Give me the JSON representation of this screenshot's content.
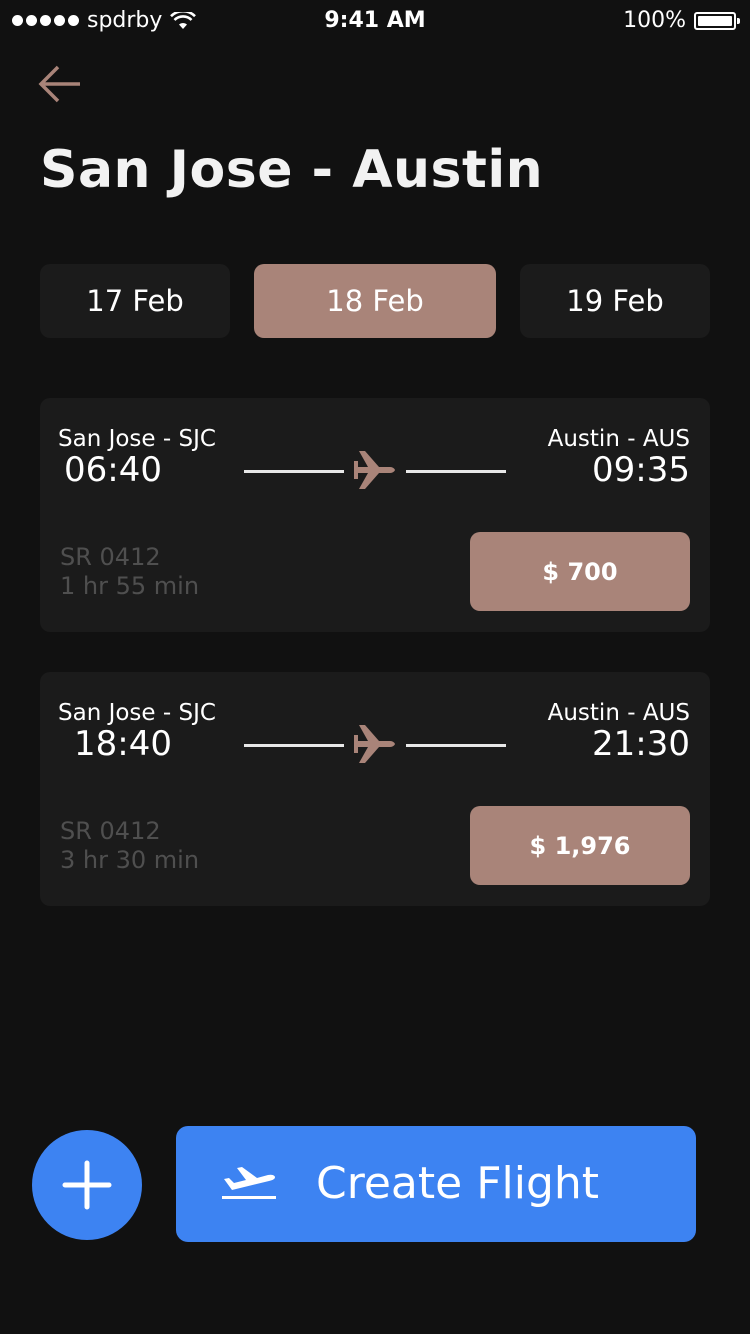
{
  "status_bar": {
    "carrier": "spdrby",
    "time": "9:41 AM",
    "battery_text": "100%",
    "battery_level": 1.0,
    "signal_bars": 5
  },
  "header": {
    "back_icon": "arrow-left-icon",
    "title": "San Jose - Austin"
  },
  "dates": [
    {
      "label": "17 Feb",
      "selected": false
    },
    {
      "label": "18 Feb",
      "selected": true
    },
    {
      "label": "19 Feb",
      "selected": false
    }
  ],
  "flights": [
    {
      "from": "San Jose - SJC",
      "to": "Austin - AUS",
      "depart": "06:40",
      "arrive": "09:35",
      "code": "SR 0412",
      "duration": "1 hr 55 min",
      "price": "$ 700"
    },
    {
      "from": "San Jose - SJC",
      "to": "Austin - AUS",
      "depart": "18:40",
      "arrive": "21:30",
      "code": "SR 0412",
      "duration": "3 hr 30 min",
      "price": "$ 1,976"
    }
  ],
  "actions": {
    "add_icon": "plus-icon",
    "create_icon": "takeoff-icon",
    "create_label": "Create Flight"
  },
  "colors": {
    "background": "#111111",
    "card": "#1b1b1b",
    "accent": "#a98479",
    "primary": "#3d83f2",
    "muted_text": "#4f4f4f"
  }
}
